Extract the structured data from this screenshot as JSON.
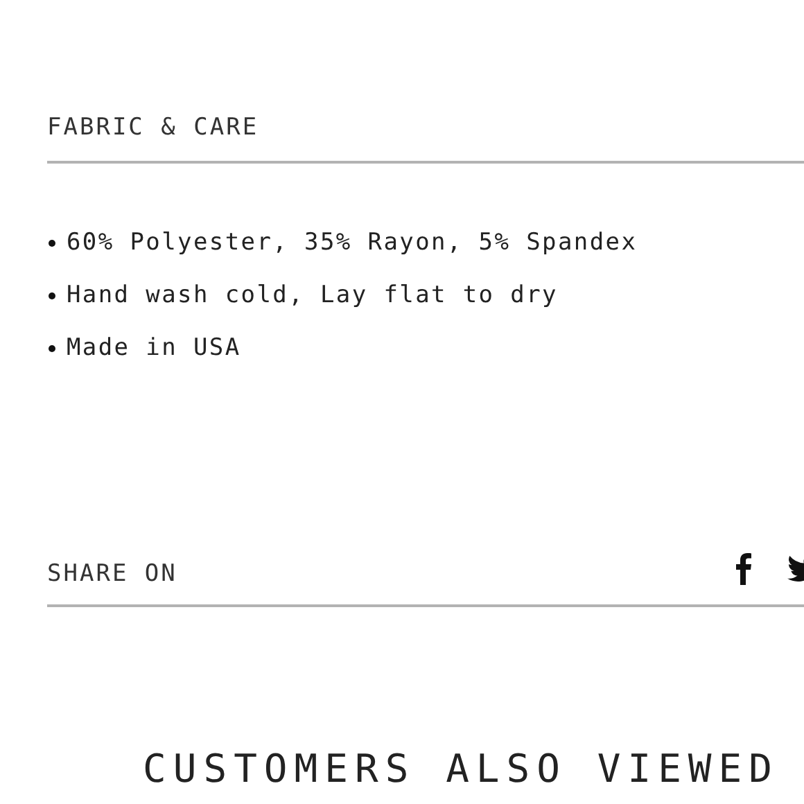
{
  "fabric_care": {
    "title": "FABRIC & CARE",
    "items": [
      "60% Polyester, 35% Rayon, 5% Spandex",
      "Hand wash cold, Lay flat to dry",
      "Made in USA"
    ]
  },
  "share": {
    "title": "SHARE ON",
    "networks": [
      {
        "kind": "facebook"
      },
      {
        "kind": "twitter"
      }
    ]
  },
  "related": {
    "title": "CUSTOMERS ALSO VIEWED"
  }
}
